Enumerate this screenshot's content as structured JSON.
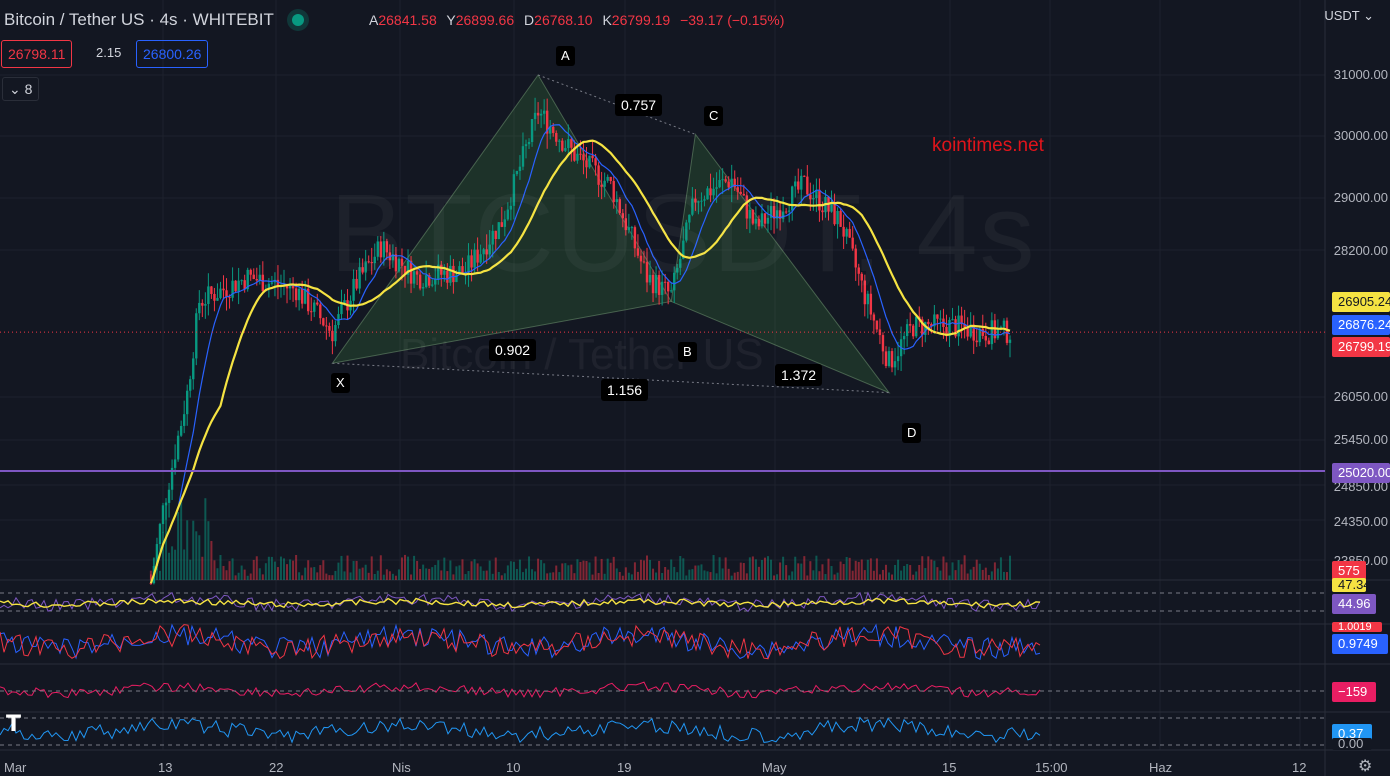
{
  "header": {
    "symbol": "Bitcoin / Tether US · 4s · WHITEBIT",
    "ohlc": [
      {
        "k": "A",
        "v": "26841.58"
      },
      {
        "k": "Y",
        "v": "26899.66"
      },
      {
        "k": "D",
        "v": "26768.10"
      },
      {
        "k": "K",
        "v": "26799.19"
      }
    ],
    "change": "−39.17 (−0.15%)",
    "bid": "26798.11",
    "spread": "2.15",
    "ask": "26800.26",
    "indicators_collapse": "8",
    "currency": "USDT"
  },
  "watermark": {
    "ticker": "BTCUSDT, 4s",
    "name": "Bitcoin / Tether US"
  },
  "annotation": "kointimes.net",
  "pattern": {
    "points": [
      {
        "label": "X",
        "price": 26290,
        "date": "Mar 27"
      },
      {
        "label": "A",
        "price": 31000,
        "date": "Apr 14"
      },
      {
        "label": "B",
        "price": 27300,
        "date": "Apr 24"
      },
      {
        "label": "C",
        "price": 30030,
        "date": "Apr 26"
      },
      {
        "label": "D",
        "price": 25810,
        "date": "May 12"
      }
    ],
    "ratios": [
      "0.757",
      "0.902",
      "1.156",
      "1.372"
    ]
  },
  "price_axis": {
    "ticks": [
      "31000.00",
      "30000.00",
      "29000.00",
      "28200.00",
      "26050.00",
      "25450.00",
      "24850.00",
      "24350.00",
      "23850.00"
    ],
    "tags": [
      {
        "text": "26905.24",
        "bg": "#f5e342",
        "fg": "#131722"
      },
      {
        "text": "26876.24",
        "bg": "#2962ff",
        "fg": "#ffffff"
      },
      {
        "text": "26799.19",
        "bg": "#f23645",
        "fg": "#ffffff"
      },
      {
        "text": "25020.00",
        "bg": "#7e57c2",
        "fg": "#ffffff"
      },
      {
        "text": "575",
        "bg": "#f23645",
        "fg": "#ffffff"
      },
      {
        "text": "47.34",
        "bg": "#f5e342",
        "fg": "#131722"
      },
      {
        "text": "44.96",
        "bg": "#7e57c2",
        "fg": "#ffffff"
      },
      {
        "text": "1.0019",
        "bg": "#f23645",
        "fg": "#ffffff"
      },
      {
        "text": "0.9749",
        "bg": "#2962ff",
        "fg": "#ffffff"
      },
      {
        "text": "−159",
        "bg": "#e91e63",
        "fg": "#ffffff"
      },
      {
        "text": "0.37",
        "bg": "#2196f3",
        "fg": "#ffffff"
      },
      {
        "text": "0.00",
        "bg": "#131722",
        "fg": "#b2b5be"
      }
    ]
  },
  "time_axis": [
    "Mar",
    "13",
    "22",
    "Nis",
    "10",
    "19",
    "May",
    "15",
    "15:00",
    "Haz",
    "12"
  ],
  "chart_data": {
    "type": "candlestick",
    "series": [
      {
        "name": "price",
        "color": "#089981"
      },
      {
        "name": "ma-yellow",
        "color": "#f5e342"
      },
      {
        "name": "ma-blue",
        "color": "#2962ff"
      }
    ],
    "last_price": 26799.19,
    "horizontal_line": 25020.0,
    "indicator_last_values": {
      "volume": 575,
      "rsi": [
        47.34,
        44.96
      ],
      "dmi": [
        1.0019,
        0.9749
      ],
      "cci": -159,
      "osc": 0.37
    }
  }
}
